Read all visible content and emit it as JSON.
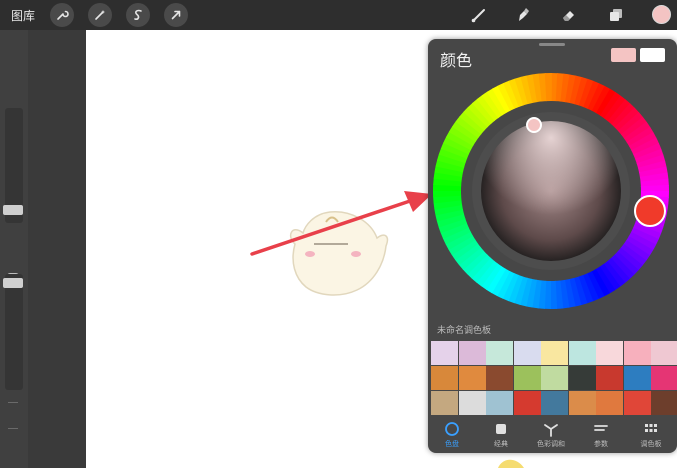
{
  "toolbar": {
    "gallery_label": "图库",
    "current_color": "#f4c4c3"
  },
  "panel": {
    "title": "颜色",
    "current_swatch": "#f4c4c3",
    "previous_swatch": "#ffffff",
    "palette_name": "未命名调色板",
    "palette_colors": [
      "#e5d2ea",
      "#dcbad9",
      "#c6e8da",
      "#d9dcef",
      "#f9e7a0",
      "#bde6e0",
      "#f8d8db",
      "#f7b0bd",
      "#efc8d2",
      "#d8883a",
      "#e08a3e",
      "#8a4a2f",
      "#9cc15c",
      "#c0dba0",
      "#363b38",
      "#c8392e",
      "#2d7dc0",
      "#e53574",
      "#c4a880",
      "#dcdcdc",
      "#9fc2d2",
      "#d53a2f",
      "#43799d",
      "#db8c4a",
      "#e0793e",
      "#e04638",
      "#6d3e2c"
    ],
    "tabs": [
      {
        "label": "色盘",
        "icon": "disc-icon"
      },
      {
        "label": "经典",
        "icon": "square-icon"
      },
      {
        "label": "色彩调和",
        "icon": "harmony-icon"
      },
      {
        "label": "参数",
        "icon": "sliders-icon"
      },
      {
        "label": "调色板",
        "icon": "grid-icon"
      }
    ]
  },
  "colors": {
    "accent": "#3aa0ff",
    "arrow": "#e8404a"
  }
}
